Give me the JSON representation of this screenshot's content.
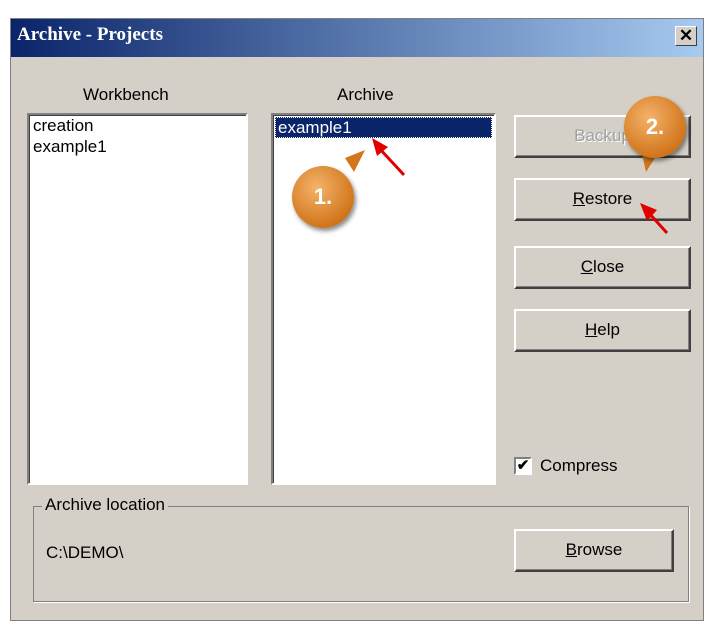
{
  "window": {
    "title": "Archive - Projects",
    "close_glyph": "✕"
  },
  "workbench": {
    "label": "Workbench",
    "items": [
      "creation",
      "example1"
    ]
  },
  "archive": {
    "label": "Archive",
    "items": [
      "example1"
    ],
    "selected": "example1"
  },
  "buttons": {
    "backup": {
      "pre": "Back",
      "acc": "",
      "post": "up",
      "enabled": false
    },
    "restore": {
      "pre": "",
      "acc": "R",
      "post": "estore"
    },
    "close": {
      "pre": "",
      "acc": "C",
      "post": "lose"
    },
    "help": {
      "pre": "",
      "acc": "H",
      "post": "elp"
    },
    "browse": {
      "pre": "",
      "acc": "B",
      "post": "rowse"
    }
  },
  "compress": {
    "label": "Compress",
    "checked": true,
    "mark": "✔"
  },
  "location": {
    "caption": "Archive location",
    "path": "C:\\DEMO\\"
  },
  "annotations": {
    "step1": "1.",
    "step2": "2.",
    "accent": "#d2761c",
    "arrow_color": "#e00000"
  }
}
